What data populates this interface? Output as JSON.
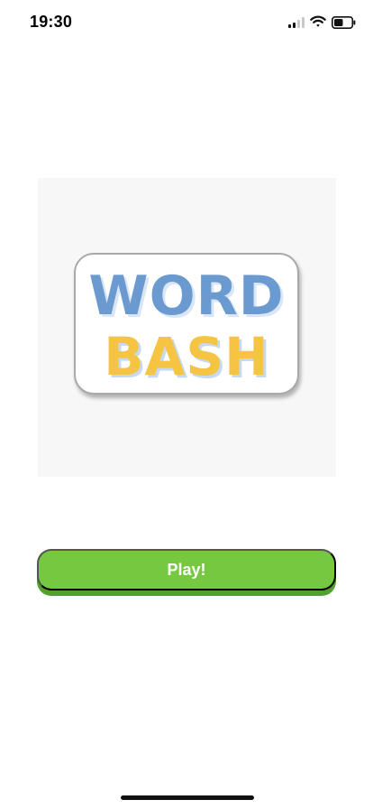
{
  "status_bar": {
    "time": "19:30",
    "icons": [
      "cellular-signal-icon",
      "wifi-icon",
      "battery-icon"
    ]
  },
  "logo": {
    "line1": "WORD",
    "line2": "BASH",
    "colors": {
      "line1": "#6b9ad1",
      "line2": "#f6c443"
    }
  },
  "actions": {
    "play_label": "Play!",
    "play_color": "#76c840"
  }
}
